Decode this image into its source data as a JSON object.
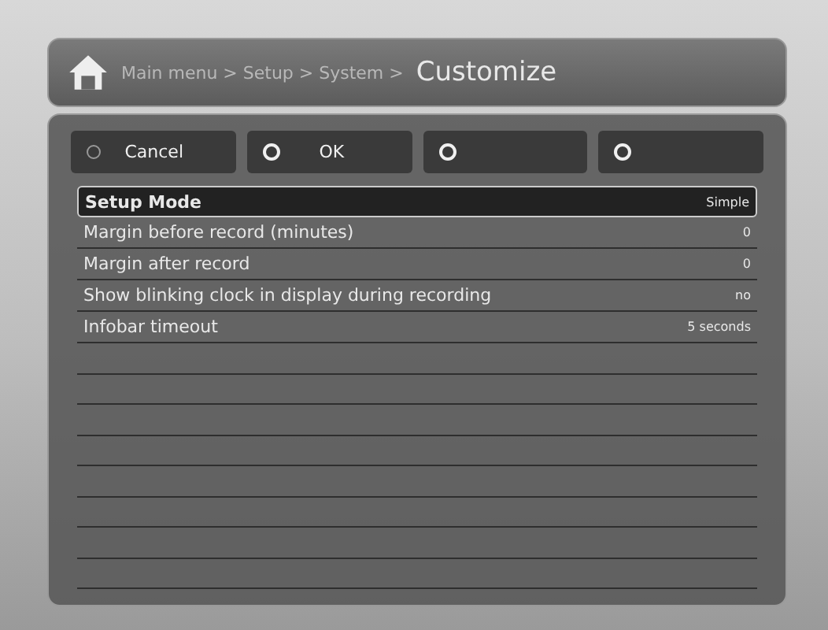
{
  "breadcrumb": {
    "path": "Main menu > Setup > System >",
    "title": "Customize"
  },
  "buttons": [
    {
      "kind": "labeled",
      "label": "Cancel"
    },
    {
      "kind": "labeled",
      "label": "OK"
    },
    {
      "kind": "blank"
    },
    {
      "kind": "blank"
    }
  ],
  "settings": [
    {
      "name": "Setup Mode",
      "value": "Simple",
      "selected": true
    },
    {
      "name": "Margin before record (minutes)",
      "value": "0",
      "selected": false
    },
    {
      "name": "Margin after record",
      "value": "0",
      "selected": false
    },
    {
      "name": "Show blinking clock in display during recording",
      "value": "no",
      "selected": false
    },
    {
      "name": "Infobar timeout",
      "value": "5 seconds",
      "selected": false
    }
  ]
}
